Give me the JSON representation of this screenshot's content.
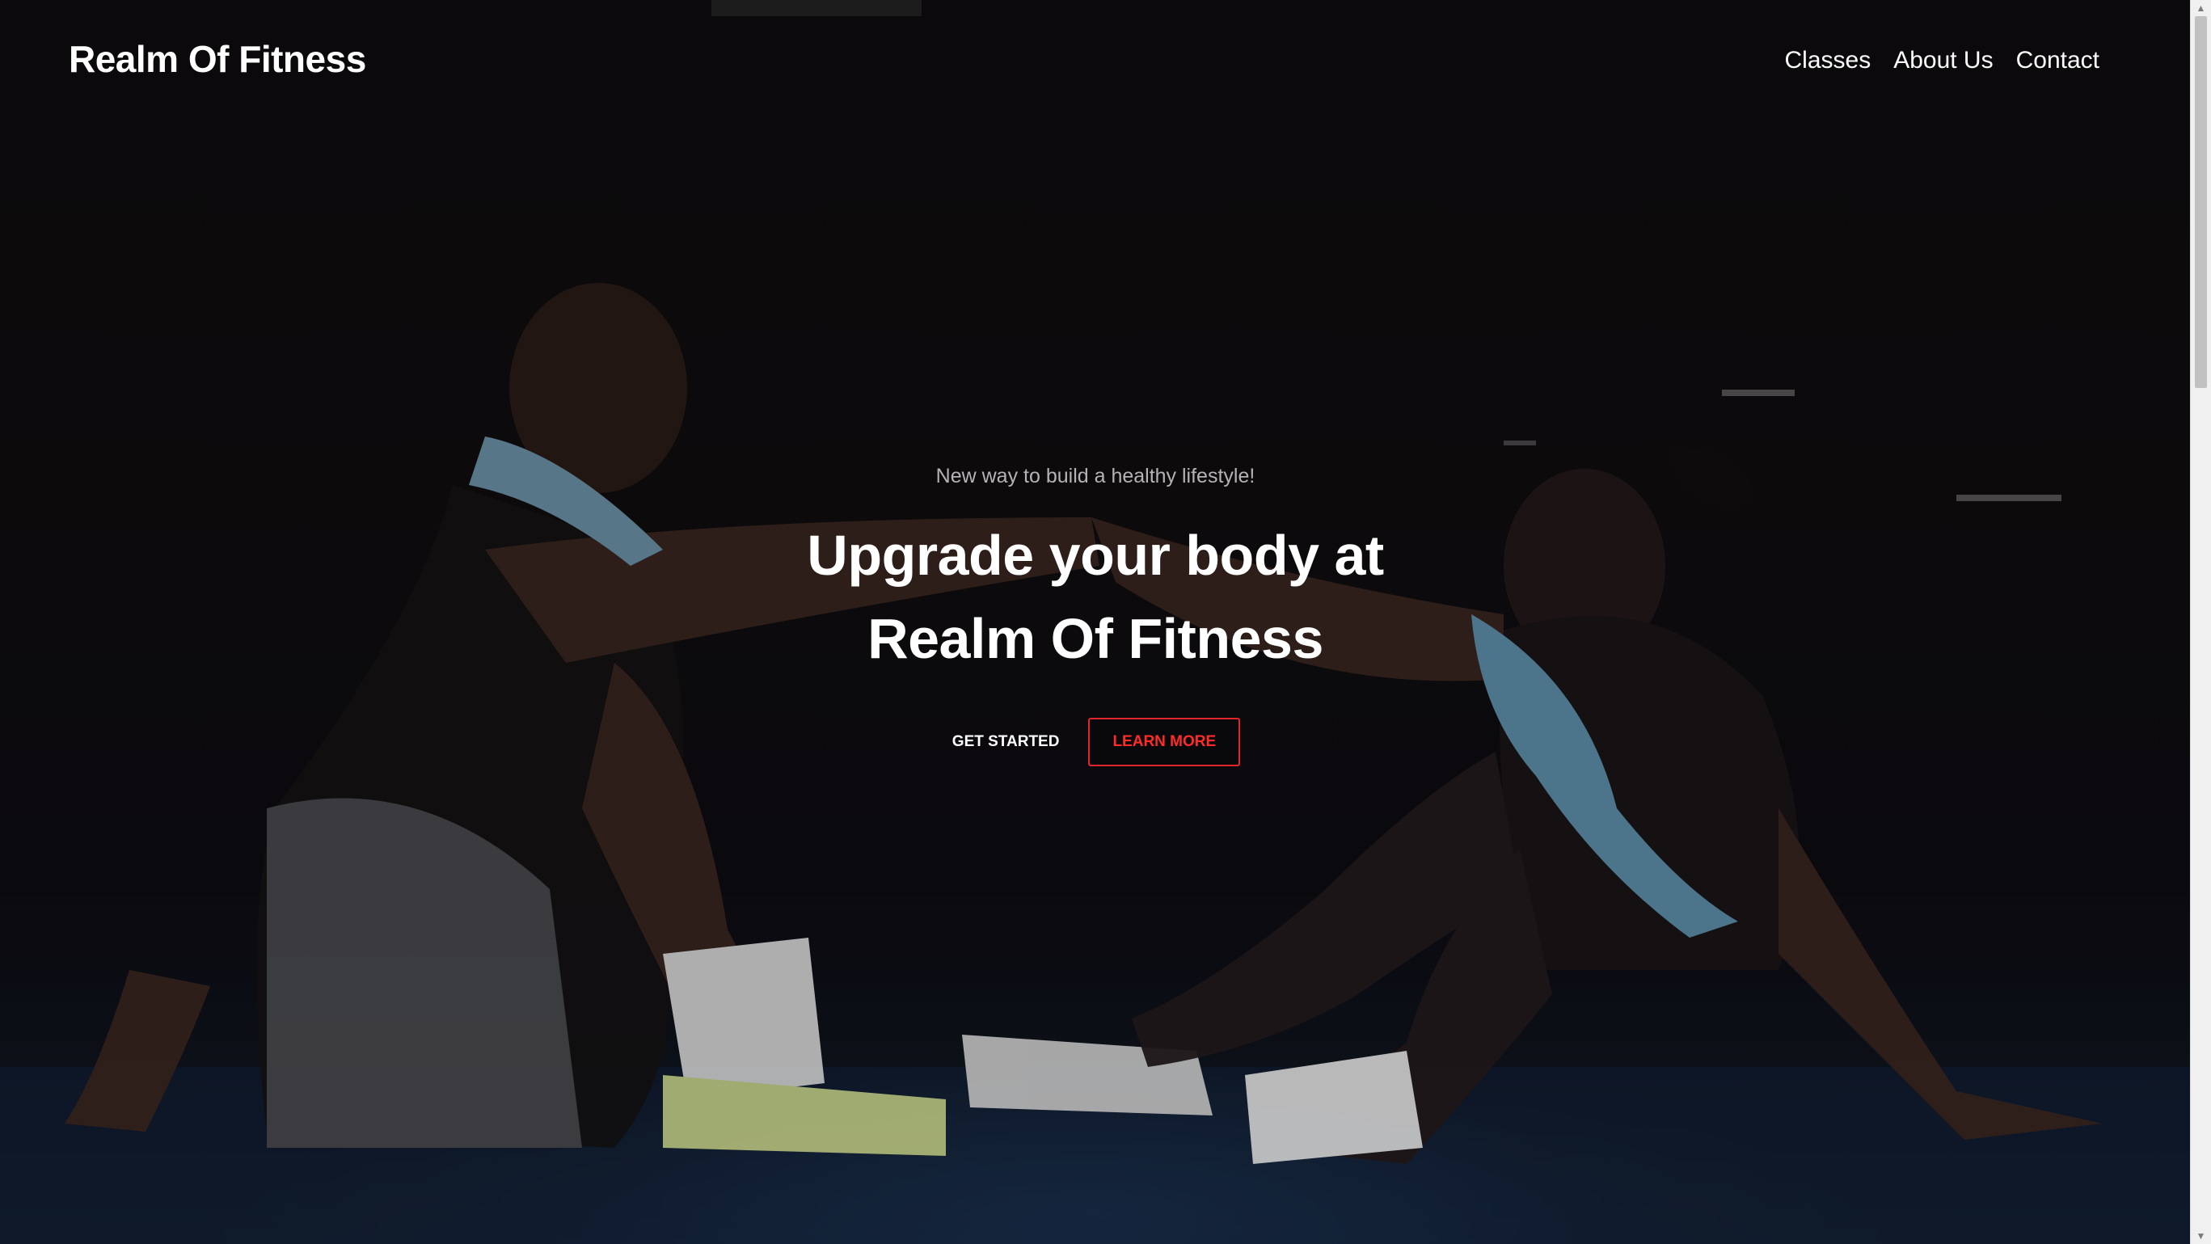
{
  "header": {
    "logo": "Realm Of Fitness",
    "nav": [
      {
        "label": "Classes"
      },
      {
        "label": "About Us"
      },
      {
        "label": "Contact"
      }
    ]
  },
  "hero": {
    "tagline": "New way to build a healthy lifestyle!",
    "headline_line1": "Upgrade your body at",
    "headline_line2": "Realm Of Fitness",
    "primary_button": "GET STARTED",
    "secondary_button": "LEARN MORE",
    "background_image": "people-sitting-on-gym-floor-high-five-photo"
  },
  "colors": {
    "accent": "#e0262b",
    "text": "#ffffff",
    "muted": "#b5b3b5",
    "background": "#0b0a0c"
  }
}
